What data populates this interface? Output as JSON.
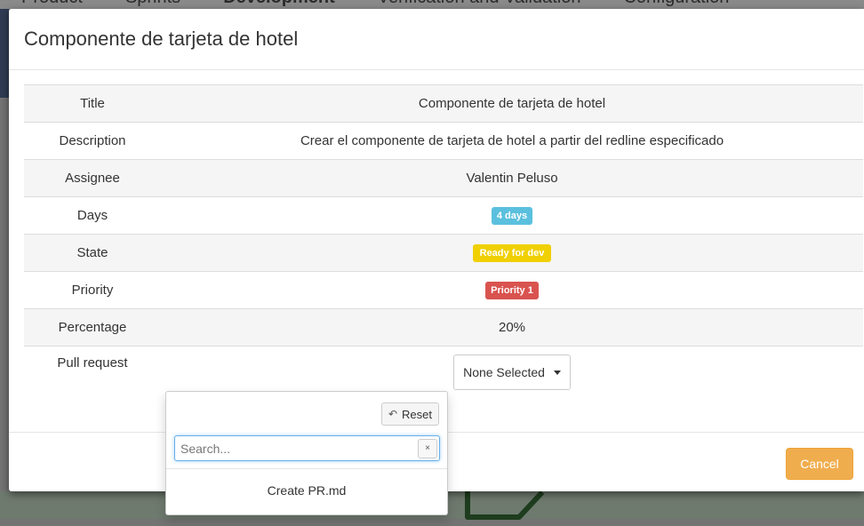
{
  "background": {
    "nav_tabs": [
      "Product",
      "Sprints",
      "Development",
      "Verification and Validation",
      "Configuration"
    ]
  },
  "modal": {
    "title": "Componente de tarjeta de hotel",
    "rows": [
      {
        "key": "Title",
        "value": "Componente de tarjeta de hotel"
      },
      {
        "key": "Description",
        "value": "Crear el componente de tarjeta de hotel a partir del redline especificado"
      },
      {
        "key": "Assignee",
        "value": "Valentin Peluso"
      },
      {
        "key": "Days",
        "value": "4 days",
        "badge_color": "#5bc0de"
      },
      {
        "key": "State",
        "value": "Ready for dev",
        "badge_color": "#f0d000"
      },
      {
        "key": "Priority",
        "value": "Priority 1",
        "badge_color": "#d9534f"
      },
      {
        "key": "Percentage",
        "value": "20%"
      },
      {
        "key": "Pull request",
        "select_value": "None Selected"
      }
    ],
    "footer": {
      "cancel_label": "Cancel",
      "cancel_color": "#f0ad4e"
    }
  },
  "pull_request_dropdown": {
    "reset_label": "Reset",
    "reset_icon": "undo-icon",
    "search_placeholder": "Search...",
    "search_value": "",
    "clear_label": "×",
    "options": [
      "Create PR.md"
    ]
  }
}
